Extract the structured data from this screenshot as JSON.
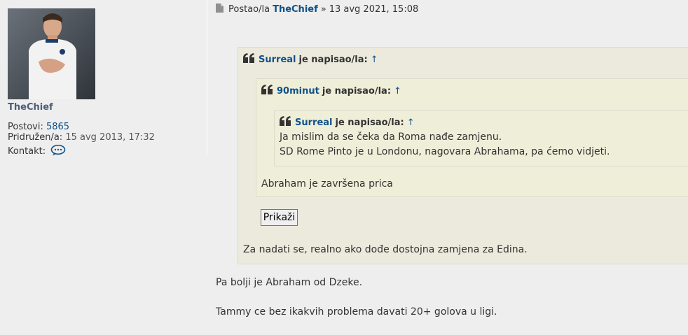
{
  "profile": {
    "username": "TheChief",
    "posts_label": "Postovi:",
    "posts_count": "5865",
    "joined_label": "Pridružen/a:",
    "joined_date": "15 avg 2013, 17:32",
    "contact_label": "Kontakt:",
    "contact_icon": "speech-bubble-icon"
  },
  "post": {
    "posted_by_label": "Postao/la",
    "author": "TheChief",
    "separator": "»",
    "datetime": "13 avg 2021, 15:08",
    "paragraphs": [
      "Pa bolji je Abraham od Dzeke.",
      "Tammy ce bez ikakvih problema davati 20+ golova u ligi."
    ]
  },
  "quotes": {
    "outer": {
      "author": "Surreal",
      "wrote": "je napisao/la:",
      "arrow": "↑",
      "text": "Za nadati se, realno ako dođe dostojna zamjena za Edina."
    },
    "middle": {
      "author": "90minut",
      "wrote": "je napisao/la:",
      "arrow": "↑",
      "text": "Abraham je završena prica"
    },
    "inner": {
      "author": "Surreal",
      "wrote": "je napisao/la:",
      "arrow": "↑",
      "lines": [
        "Ja mislim da se čeka da Roma nađe zamjenu.",
        "SD Rome Pinto je u Londonu, nagovara Abrahama, pa ćemo vidjeti."
      ]
    },
    "show_button": "Prikaži"
  },
  "colors": {
    "link": "#105289",
    "username": "#4c5d77",
    "quote_bg": "#ebeadd",
    "page_bg": "#eeeeee"
  }
}
